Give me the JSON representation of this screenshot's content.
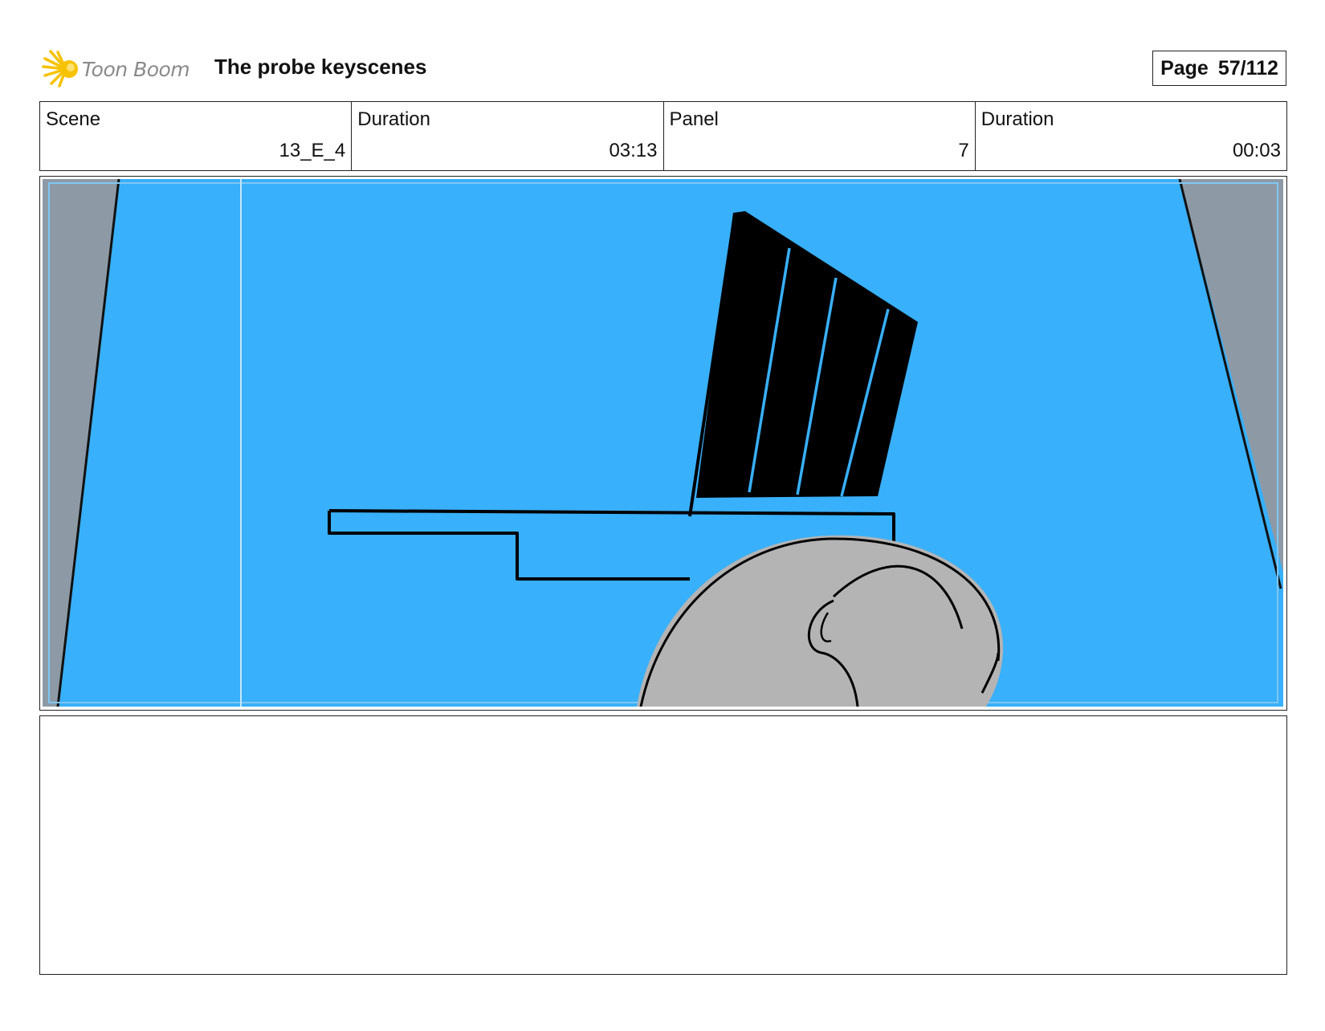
{
  "header": {
    "logo_text": "Toon Boom",
    "logo_icon": "toon-boom-star-burst",
    "title": "The probe keyscenes",
    "page_label": "Page",
    "page_number": "57/112"
  },
  "info": {
    "scene_label": "Scene",
    "scene_value": "13_E_4",
    "scene_duration_label": "Duration",
    "scene_duration_value": "03:13",
    "panel_label": "Panel",
    "panel_value": "7",
    "panel_duration_label": "Duration",
    "panel_duration_value": "00:03"
  },
  "panel_image": {
    "description_colors": {
      "sky": "#38b0fb",
      "side_wall": "#8d9aa6",
      "head": "#b4b4b4",
      "ink": "#000000"
    }
  },
  "notes": {
    "text": ""
  },
  "colors": {
    "logo_accent": "#f7c200",
    "logo_text": "#8a8a8a",
    "border": "#222222"
  }
}
